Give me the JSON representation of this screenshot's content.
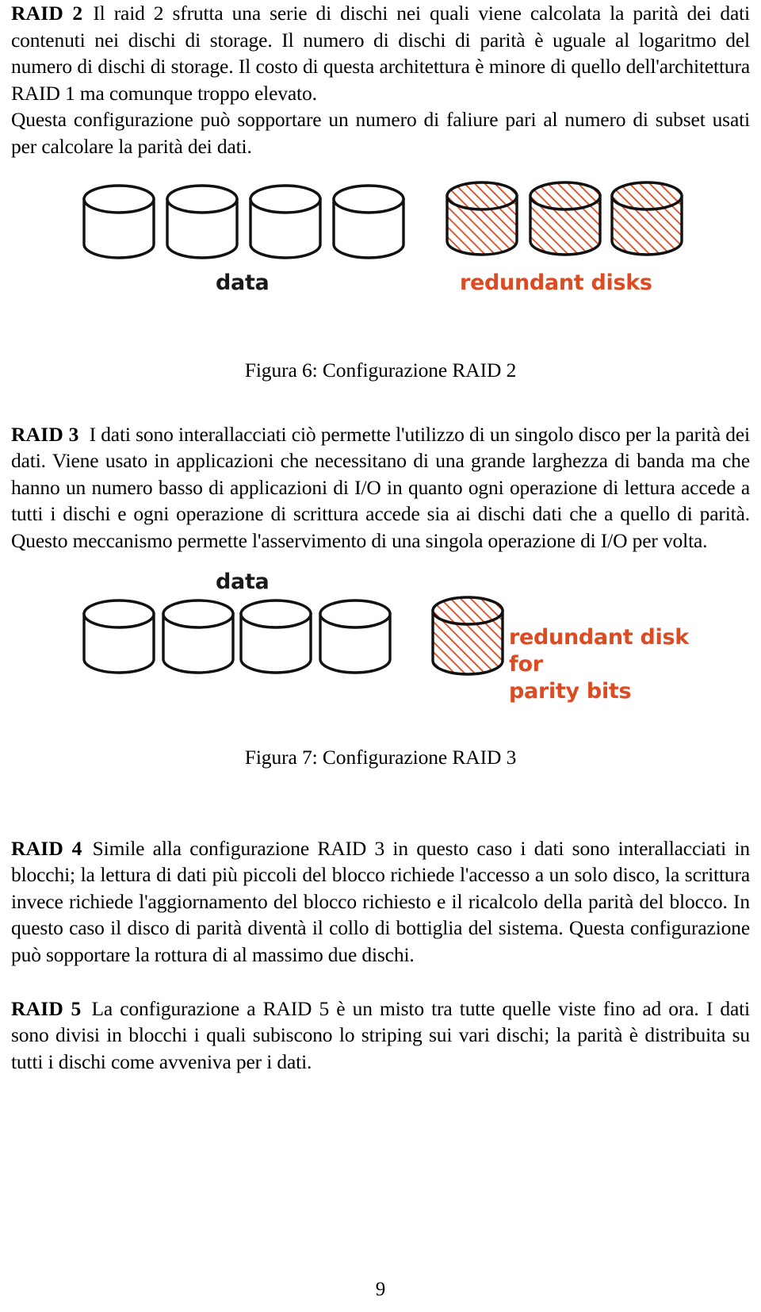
{
  "document": {
    "language": "Italian",
    "page_number": "9"
  },
  "sections": {
    "raid2": {
      "heading": "RAID 2",
      "paragraph_1": "Il raid 2 sfrutta una serie di dischi nei quali viene calcolata la parità dei dati contenuti nei dischi di storage. Il numero di dischi di parità è uguale al logaritmo del numero di dischi di storage. Il costo di questa architettura è minore di quello dell'architettura RAID 1 ma comunque troppo elevato.",
      "paragraph_2": "Questa configurazione può sopportare un numero di faliure pari al numero di subset usati per calcolare la parità dei dati."
    },
    "raid3": {
      "heading": "RAID 3",
      "paragraph_1": "I dati sono interallacciati ciò permette l'utilizzo di un singolo disco per la parità dei dati. Viene usato in applicazioni che necessitano di una grande larghezza di banda ma che hanno un numero basso di applicazioni di I/O in quanto ogni operazione di lettura accede a tutti i dischi e ogni operazione di scrittura accede sia ai dischi dati che a quello di parità. Questo meccanismo permette l'asservimento di una singola operazione di I/O per volta."
    },
    "raid4": {
      "heading": "RAID 4",
      "paragraph_1": "Simile alla configurazione RAID 3 in questo caso i dati sono interallacciati in blocchi; la lettura di dati più piccoli del blocco richiede l'accesso a un solo disco, la scrittura invece richiede l'aggiornamento del blocco richiesto e il ricalcolo della parità del blocco. In questo caso il disco di parità diventà il collo di bottiglia del sistema. Questa configurazione può sopportare la rottura di al massimo due dischi."
    },
    "raid5": {
      "heading": "RAID 5",
      "paragraph_1": "La configurazione a RAID 5 è un misto tra tutte quelle viste fino ad ora. I dati sono divisi in blocchi i quali subiscono lo striping sui vari dischi; la parità è distribuita su tutti i dischi come avveniva per i dati."
    }
  },
  "figures": {
    "figure6": {
      "caption": "Figura 6: Configurazione RAID 2",
      "data_label": "data",
      "redundant_label": "redundant disks",
      "data_disk_count": 4,
      "redundant_disk_count": 3,
      "accent_color": "#DD4B22",
      "outline_color": "#111111"
    },
    "figure7": {
      "caption": "Figura 7: Configurazione RAID 3",
      "data_label": "data",
      "redundant_label_line1": "redundant disk for",
      "redundant_label_line2": "parity bits",
      "data_disk_count": 4,
      "redundant_disk_count": 1,
      "accent_color": "#DD4B22",
      "outline_color": "#111111"
    }
  }
}
